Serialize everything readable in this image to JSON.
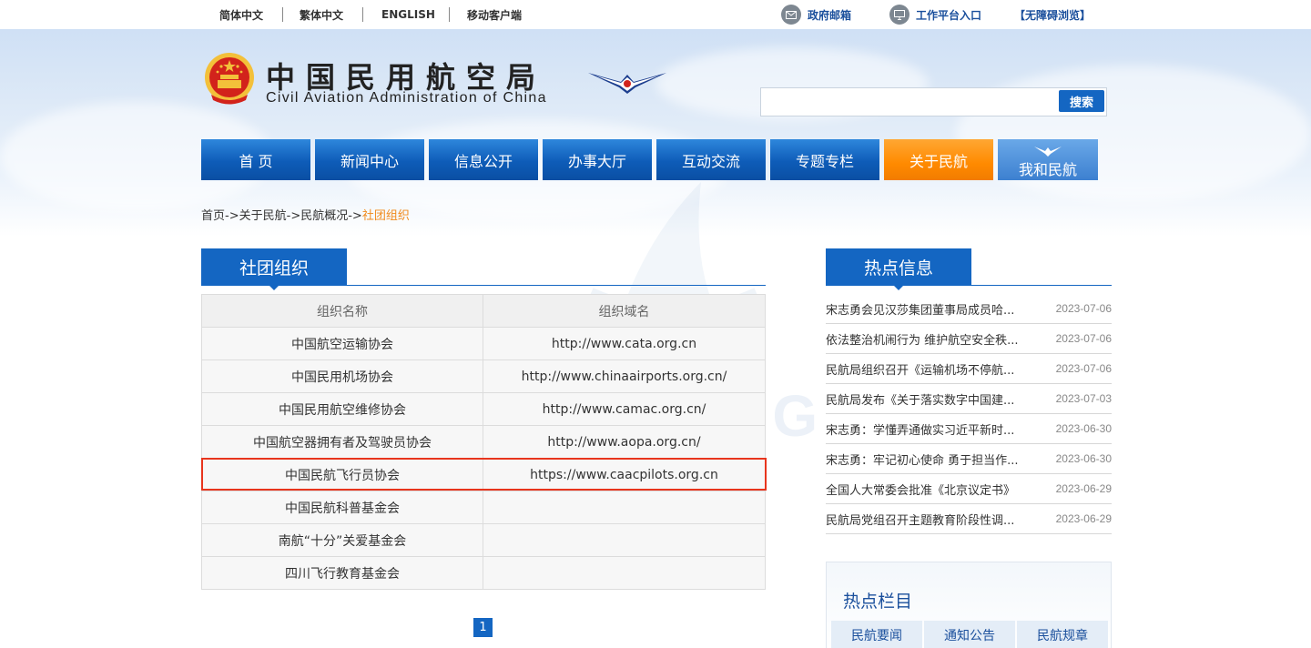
{
  "topbar": {
    "lang_simplified": "简体中文",
    "lang_traditional": "繁体中文",
    "lang_english": "ENGLISH",
    "mobile": "移动客户端",
    "gov_mail": "政府邮箱",
    "workbench": "工作平台入口",
    "accessible": "【无障碍浏览】"
  },
  "header": {
    "title_cn": "中国民用航空局",
    "title_en": "Civil Aviation Administration of China",
    "search_placeholder": "",
    "search_button": "搜索"
  },
  "nav": [
    {
      "label": "首 页"
    },
    {
      "label": "新闻中心"
    },
    {
      "label": "信息公开"
    },
    {
      "label": "办事大厅"
    },
    {
      "label": "互动交流"
    },
    {
      "label": "专题专栏"
    },
    {
      "label": "关于民航"
    },
    {
      "label": "我和民航"
    }
  ],
  "breadcrumb": {
    "home": "首页",
    "sep": "->",
    "about": "关于民航",
    "overview": "民航概况",
    "current": "社团组织"
  },
  "watermark": "YOUHANG",
  "section": {
    "title": "社团组织",
    "columns": [
      "组织名称",
      "组织域名"
    ],
    "rows": [
      {
        "name": "中国航空运输协会",
        "domain": "http://www.cata.org.cn"
      },
      {
        "name": "中国民用机场协会",
        "domain": "http://www.chinaairports.org.cn/"
      },
      {
        "name": "中国民用航空维修协会",
        "domain": "http://www.camac.org.cn/"
      },
      {
        "name": "中国航空器拥有者及驾驶员协会",
        "domain": "http://www.aopa.org.cn/"
      },
      {
        "name": "中国民航飞行员协会",
        "domain": "https://www.caacpilots.org.cn"
      },
      {
        "name": "中国民航科普基金会",
        "domain": ""
      },
      {
        "name": "南航“十分”关爱基金会",
        "domain": ""
      },
      {
        "name": "四川飞行教育基金会",
        "domain": ""
      }
    ],
    "page": "1"
  },
  "hot": {
    "title": "热点信息",
    "items": [
      {
        "title": "宋志勇会见汉莎集团董事局成员哈...",
        "date": "2023-07-06"
      },
      {
        "title": "依法整治机闹行为 维护航空安全秩...",
        "date": "2023-07-06"
      },
      {
        "title": "民航局组织召开《运输机场不停航...",
        "date": "2023-07-06"
      },
      {
        "title": "民航局发布《关于落实数字中国建...",
        "date": "2023-07-03"
      },
      {
        "title": "宋志勇：学懂弄通做实习近平新时...",
        "date": "2023-06-30"
      },
      {
        "title": "宋志勇：牢记初心使命 勇于担当作...",
        "date": "2023-06-30"
      },
      {
        "title": "全国人大常委会批准《北京议定书》",
        "date": "2023-06-29"
      },
      {
        "title": "民航局党组召开主题教育阶段性调...",
        "date": "2023-06-29"
      }
    ]
  },
  "hot_columns": {
    "title": "热点栏目",
    "buttons": [
      "民航要闻",
      "通知公告",
      "民航规章"
    ]
  },
  "colors": {
    "primary_blue": "#1466c2",
    "nav_active_orange": "#ff8a00",
    "breadcrumb_current": "#f08a1c",
    "highlight_red": "#e8351d"
  }
}
